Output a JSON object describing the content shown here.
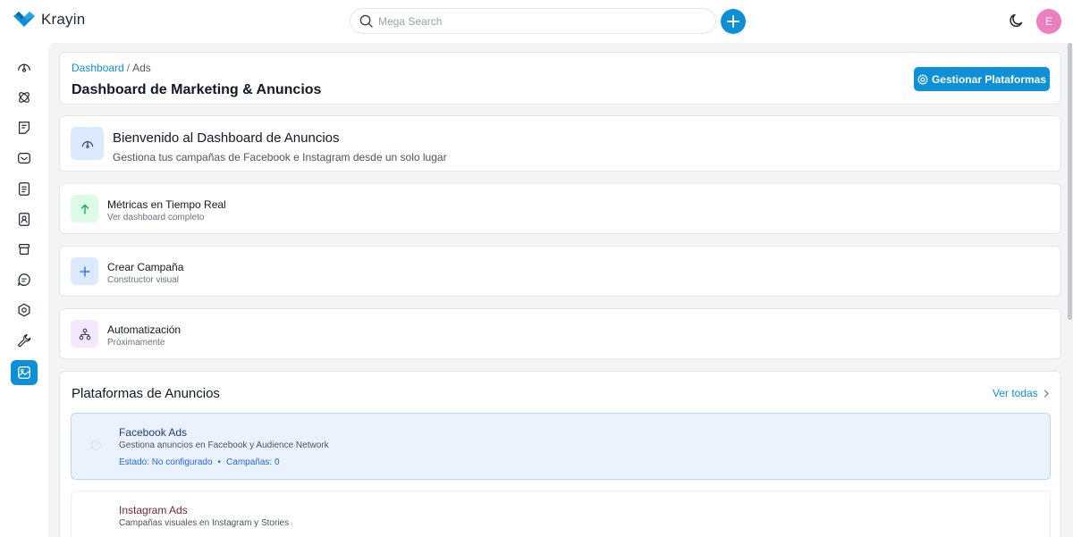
{
  "app": {
    "brand": "Krayin"
  },
  "header": {
    "search_placeholder": "Mega Search",
    "avatar_initial": "E"
  },
  "breadcrumb": {
    "root": "Dashboard",
    "separator": "/",
    "current": "Ads"
  },
  "page": {
    "title": "Dashboard de Marketing & Anuncios",
    "manage_button": "Gestionar Plataformas"
  },
  "welcome": {
    "title": "Bienvenido al Dashboard de Anuncios",
    "subtitle": "Gestiona tus campañas de Facebook e Instagram desde un solo lugar"
  },
  "features": [
    {
      "title": "Métricas en Tiempo Real",
      "subtitle": "Ver dashboard completo"
    },
    {
      "title": "Crear Campaña",
      "subtitle": "Constructor visual"
    },
    {
      "title": "Automatización",
      "subtitle": "Próximamente"
    }
  ],
  "platforms_section": {
    "title": "Plataformas de Anuncios",
    "see_all": "Ver todas",
    "items": [
      {
        "name": "Facebook Ads",
        "description": "Gestiona anuncios en Facebook y Audience Network",
        "status": "Estado: No configurado",
        "campaigns": "Campañas: 0"
      },
      {
        "name": "Instagram Ads",
        "description": "Campañas visuales en Instagram y Stories"
      }
    ]
  },
  "colors": {
    "accent": "#0e90d9",
    "facebook_title": "#1e3a8a",
    "instagram_title": "#7a1f3d",
    "avatar": "#ec7fbf"
  },
  "sidebar_icons": [
    "dashboard-icon",
    "leads-icon",
    "quotes-icon",
    "mail-icon",
    "activities-icon",
    "contacts-icon",
    "products-icon",
    "chat-icon",
    "settings-icon",
    "configuration-icon",
    "ads-icon"
  ]
}
